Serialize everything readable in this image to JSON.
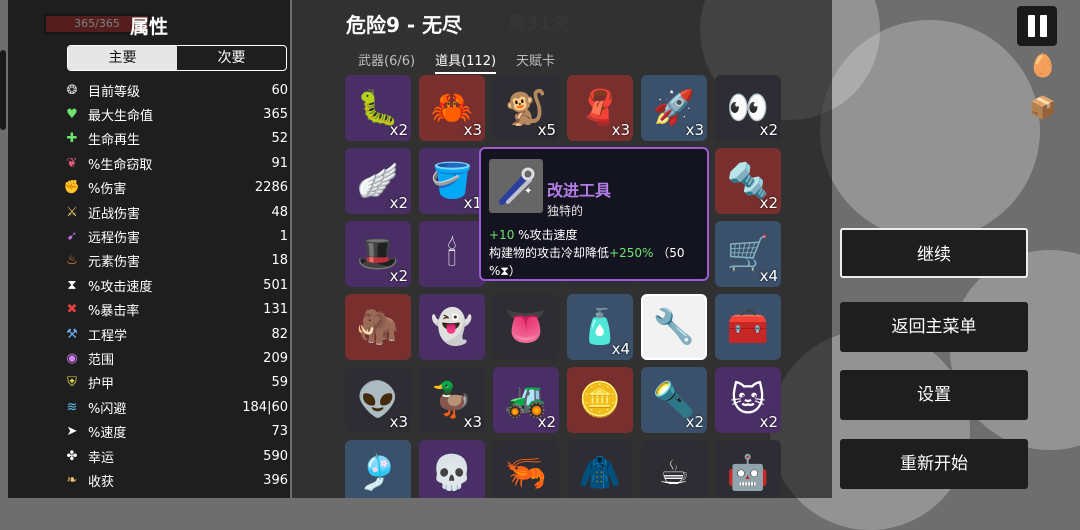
{
  "hud": {
    "hp_text": "365/365"
  },
  "stats": {
    "title": "属性",
    "tabs": [
      {
        "label": "主要"
      },
      {
        "label": "次要"
      }
    ],
    "rows": [
      {
        "icon": "level-icon",
        "glyph": "❂",
        "color": "#dddddd",
        "label": "目前等级",
        "value": "60"
      },
      {
        "icon": "heart-icon",
        "glyph": "♥",
        "color": "#6fe36f",
        "label": "最大生命值",
        "value": "365"
      },
      {
        "icon": "regen-icon",
        "glyph": "✚",
        "color": "#6fe36f",
        "label": "生命再生",
        "value": "52"
      },
      {
        "icon": "lifesteal-icon",
        "glyph": "❦",
        "color": "#e05a7a",
        "label": "%生命窃取",
        "value": "91"
      },
      {
        "icon": "damage-icon",
        "glyph": "✊",
        "color": "#e05a5a",
        "label": "%伤害",
        "value": "2286"
      },
      {
        "icon": "melee-icon",
        "glyph": "⚔",
        "color": "#f0d060",
        "label": "近战伤害",
        "value": "48"
      },
      {
        "icon": "ranged-icon",
        "glyph": "➹",
        "color": "#c070e0",
        "label": "远程伤害",
        "value": "1"
      },
      {
        "icon": "elemental-icon",
        "glyph": "♨",
        "color": "#f09040",
        "label": "元素伤害",
        "value": "18"
      },
      {
        "icon": "attack-speed-icon",
        "glyph": "⧗",
        "color": "#ffffff",
        "label": "%攻击速度",
        "value": "501"
      },
      {
        "icon": "crit-icon",
        "glyph": "✖",
        "color": "#e04040",
        "label": "%暴击率",
        "value": "131"
      },
      {
        "icon": "engineering-icon",
        "glyph": "⚒",
        "color": "#6ab0f0",
        "label": "工程学",
        "value": "82"
      },
      {
        "icon": "range-icon",
        "glyph": "◉",
        "color": "#d080f0",
        "label": "范围",
        "value": "209"
      },
      {
        "icon": "armor-icon",
        "glyph": "⛨",
        "color": "#f0e050",
        "label": "护甲",
        "value": "59"
      },
      {
        "icon": "dodge-icon",
        "glyph": "≋",
        "color": "#60c0f0",
        "label": "%闪避",
        "value": "184|60"
      },
      {
        "icon": "speed-icon",
        "glyph": "➤",
        "color": "#ffffff",
        "label": "%速度",
        "value": "73"
      },
      {
        "icon": "luck-icon",
        "glyph": "✤",
        "color": "#ffffff",
        "label": "幸运",
        "value": "590"
      },
      {
        "icon": "harvest-icon",
        "glyph": "❧",
        "color": "#f0c070",
        "label": "收获",
        "value": "396"
      }
    ]
  },
  "run": {
    "title": "危险9 - 无尽",
    "wave": "第31波"
  },
  "item_tabs": [
    {
      "label": "武器(6/6)"
    },
    {
      "label": "道具(112)"
    },
    {
      "label": "天赋卡"
    }
  ],
  "items": [
    {
      "name": "tardigrade-item",
      "glyph": "🐛",
      "tier": "rare",
      "count": "x2"
    },
    {
      "name": "claw-item",
      "glyph": "🦀",
      "tier": "legend",
      "count": "x3"
    },
    {
      "name": "monkey-item",
      "glyph": "🐒",
      "tier": "common",
      "count": "x5"
    },
    {
      "name": "cape-item",
      "glyph": "🧣",
      "tier": "legend",
      "count": "x3"
    },
    {
      "name": "rocket-item",
      "glyph": "🚀",
      "tier": "uncommon",
      "count": "x3"
    },
    {
      "name": "eyes-item",
      "glyph": "👀",
      "tier": "common",
      "count": "x2"
    },
    {
      "name": "wings-item",
      "glyph": "🪽",
      "tier": "rare",
      "count": "x2"
    },
    {
      "name": "bucket-item",
      "glyph": "🪣",
      "tier": "rare",
      "count": "x1"
    },
    {
      "name": "hidden-item-a",
      "glyph": "",
      "tier": "common",
      "count": ""
    },
    {
      "name": "hidden-item-b",
      "glyph": "",
      "tier": "common",
      "count": ""
    },
    {
      "name": "hidden-item-c",
      "glyph": "",
      "tier": "common",
      "count": ""
    },
    {
      "name": "bullet-item",
      "glyph": "🔩",
      "tier": "legend",
      "count": "x2"
    },
    {
      "name": "bowler-hat-item",
      "glyph": "🎩",
      "tier": "rare",
      "count": "x2"
    },
    {
      "name": "candle-item",
      "glyph": "🕯",
      "tier": "rare",
      "count": ""
    },
    {
      "name": "hidden-item-d",
      "glyph": "",
      "tier": "common",
      "count": ""
    },
    {
      "name": "hidden-item-e",
      "glyph": "",
      "tier": "common",
      "count": ""
    },
    {
      "name": "hidden-item-f",
      "glyph": "",
      "tier": "common",
      "count": ""
    },
    {
      "name": "wheelbarrow-item",
      "glyph": "🛒",
      "tier": "uncommon",
      "count": "x4"
    },
    {
      "name": "mammoth-item",
      "glyph": "🦣",
      "tier": "legend",
      "count": ""
    },
    {
      "name": "ghost-fire-item",
      "glyph": "👻",
      "tier": "rare",
      "count": ""
    },
    {
      "name": "tongue-item",
      "glyph": "👅",
      "tier": "common",
      "count": ""
    },
    {
      "name": "sauce-bottle-item",
      "glyph": "🧴",
      "tier": "uncommon",
      "count": "x4"
    },
    {
      "name": "improved-tools-item",
      "glyph": "🔧",
      "tier": "selected",
      "count": ""
    },
    {
      "name": "turret-item",
      "glyph": "🧰",
      "tier": "uncommon",
      "count": ""
    },
    {
      "name": "alien-item",
      "glyph": "👽",
      "tier": "common",
      "count": "x3"
    },
    {
      "name": "duck-item",
      "glyph": "🦆",
      "tier": "common",
      "count": "x3"
    },
    {
      "name": "tractor-item",
      "glyph": "🚜",
      "tier": "rare",
      "count": "x2"
    },
    {
      "name": "coin-item",
      "glyph": "🪙",
      "tier": "legend",
      "count": ""
    },
    {
      "name": "flashlight-item",
      "glyph": "🔦",
      "tier": "uncommon",
      "count": "x2"
    },
    {
      "name": "cat-item",
      "glyph": "🐱",
      "tier": "rare",
      "count": "x2"
    },
    {
      "name": "scarf-item",
      "glyph": "🎐",
      "tier": "uncommon",
      "count": ""
    },
    {
      "name": "pink-skull-item",
      "glyph": "💀",
      "tier": "rare",
      "count": ""
    },
    {
      "name": "shrimp-item",
      "glyph": "🦐",
      "tier": "common",
      "count": ""
    },
    {
      "name": "plaid-item",
      "glyph": "🧥",
      "tier": "common",
      "count": ""
    },
    {
      "name": "coffee-item",
      "glyph": "☕",
      "tier": "common",
      "count": ""
    },
    {
      "name": "robot-item",
      "glyph": "🤖",
      "tier": "common",
      "count": ""
    }
  ],
  "tooltip": {
    "name": "改进工具",
    "rarity": "独特的",
    "line1_value": "+10",
    "line1_text": " %攻击速度",
    "line2_prefix": "构建物的攻击冷却降低",
    "line2_value": "+250%",
    "line2_suffix": " （50 %⧗）",
    "border_color": "#9b5cd6"
  },
  "actions": {
    "continue": "继续",
    "main_menu": "返回主菜单",
    "settings": "设置",
    "restart": "重新开始"
  }
}
